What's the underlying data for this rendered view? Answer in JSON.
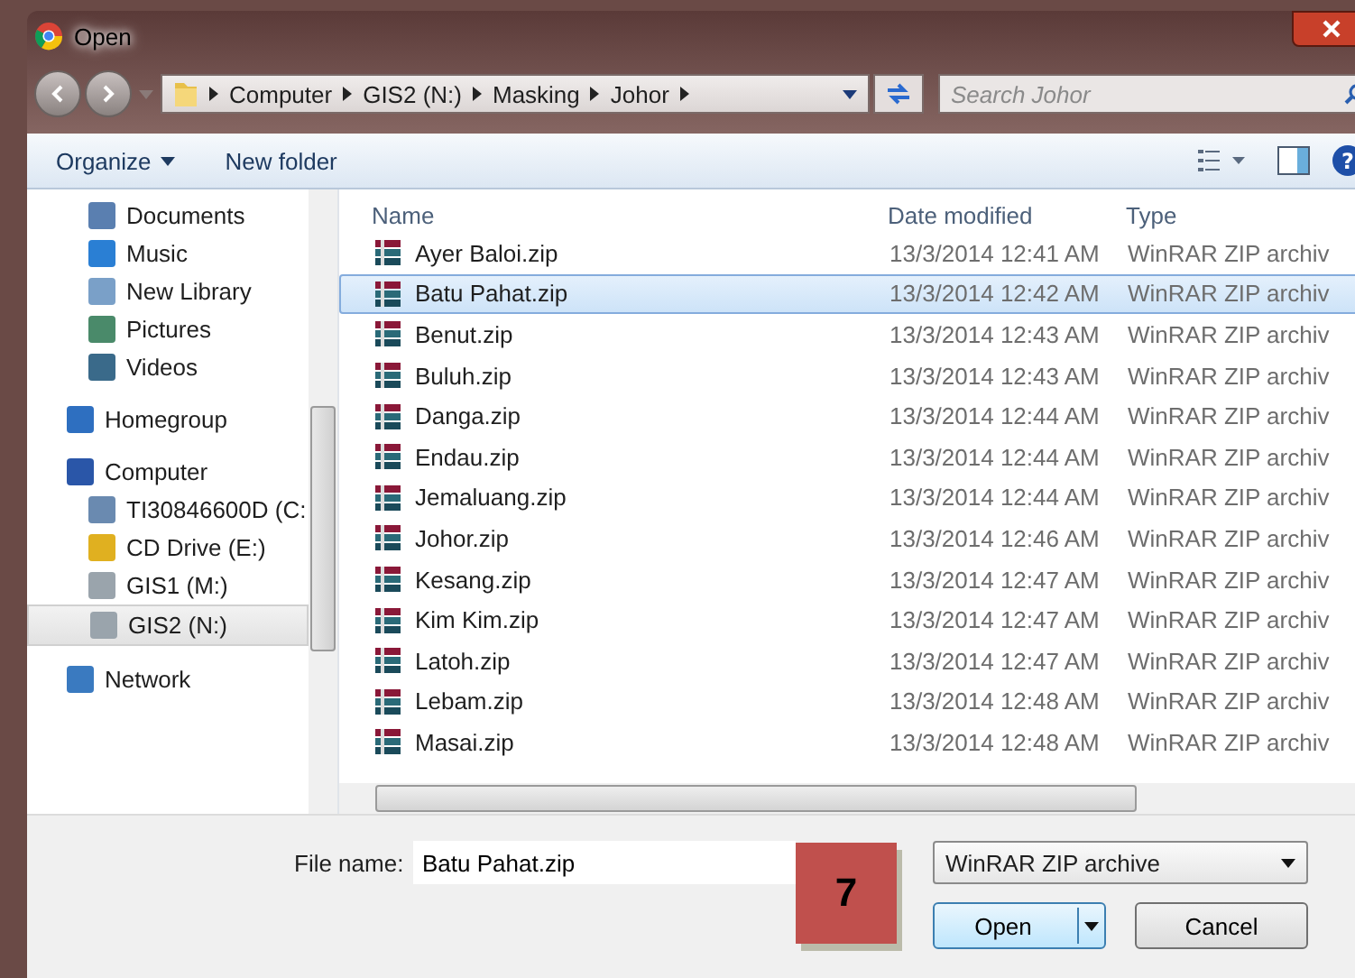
{
  "window": {
    "title": "Open"
  },
  "address": {
    "segments": [
      "Computer",
      "GIS2 (N:)",
      "Masking",
      "Johor"
    ]
  },
  "search": {
    "placeholder": "Search Johor"
  },
  "toolbar": {
    "organize": "Organize",
    "new_folder": "New folder",
    "help": "?"
  },
  "nav": [
    {
      "children": [
        {
          "label": "Documents",
          "kind": "documents",
          "selected": false
        },
        {
          "label": "Music",
          "kind": "music",
          "selected": false
        },
        {
          "label": "New Library",
          "kind": "library",
          "selected": false
        },
        {
          "label": "Pictures",
          "kind": "pictures",
          "selected": false
        },
        {
          "label": "Videos",
          "kind": "videos",
          "selected": false
        }
      ]
    },
    {
      "label": "Homegroup",
      "kind": "homegroup",
      "selected": false
    },
    {
      "label": "Computer",
      "kind": "computer",
      "selected": false,
      "children": [
        {
          "label": "TI30846600D (C:",
          "kind": "os-drive",
          "selected": false
        },
        {
          "label": "CD Drive (E:)",
          "kind": "cd-drive",
          "selected": false
        },
        {
          "label": "GIS1 (M:)",
          "kind": "drive",
          "selected": false
        },
        {
          "label": "GIS2 (N:)",
          "kind": "drive",
          "selected": true
        }
      ]
    },
    {
      "label": "Network",
      "kind": "network",
      "selected": false
    }
  ],
  "columns": [
    "Name",
    "Date modified",
    "Type"
  ],
  "rows": [
    {
      "name": "Ayer Baloi.zip",
      "date": "13/3/2014 12:41 AM",
      "type": "WinRAR ZIP archiv",
      "selected": false
    },
    {
      "name": "Batu Pahat.zip",
      "date": "13/3/2014 12:42 AM",
      "type": "WinRAR ZIP archiv",
      "selected": true
    },
    {
      "name": "Benut.zip",
      "date": "13/3/2014 12:43 AM",
      "type": "WinRAR ZIP archiv",
      "selected": false
    },
    {
      "name": "Buluh.zip",
      "date": "13/3/2014 12:43 AM",
      "type": "WinRAR ZIP archiv",
      "selected": false
    },
    {
      "name": "Danga.zip",
      "date": "13/3/2014 12:44 AM",
      "type": "WinRAR ZIP archiv",
      "selected": false
    },
    {
      "name": "Endau.zip",
      "date": "13/3/2014 12:44 AM",
      "type": "WinRAR ZIP archiv",
      "selected": false
    },
    {
      "name": "Jemaluang.zip",
      "date": "13/3/2014 12:44 AM",
      "type": "WinRAR ZIP archiv",
      "selected": false
    },
    {
      "name": "Johor.zip",
      "date": "13/3/2014 12:46 AM",
      "type": "WinRAR ZIP archiv",
      "selected": false
    },
    {
      "name": "Kesang.zip",
      "date": "13/3/2014 12:47 AM",
      "type": "WinRAR ZIP archiv",
      "selected": false
    },
    {
      "name": "Kim Kim.zip",
      "date": "13/3/2014 12:47 AM",
      "type": "WinRAR ZIP archiv",
      "selected": false
    },
    {
      "name": "Latoh.zip",
      "date": "13/3/2014 12:47 AM",
      "type": "WinRAR ZIP archiv",
      "selected": false
    },
    {
      "name": "Lebam.zip",
      "date": "13/3/2014 12:48 AM",
      "type": "WinRAR ZIP archiv",
      "selected": false
    },
    {
      "name": "Masai.zip",
      "date": "13/3/2014 12:48 AM",
      "type": "WinRAR ZIP archiv",
      "selected": false
    }
  ],
  "file_name": {
    "label": "File name:",
    "value": "Batu Pahat.zip"
  },
  "file_type": {
    "value": "WinRAR ZIP archive"
  },
  "buttons": {
    "open": "Open",
    "cancel": "Cancel"
  },
  "step_badge": "7"
}
